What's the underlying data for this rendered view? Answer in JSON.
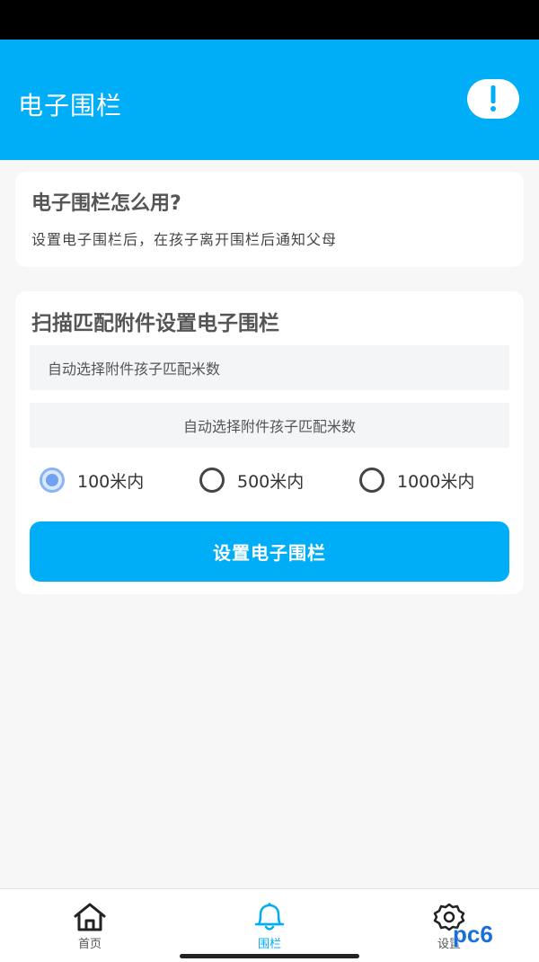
{
  "header": {
    "title": "电子围栏",
    "info_icon": "exclamation-icon"
  },
  "colors": {
    "accent": "#00adf7",
    "background": "#f7f7f7",
    "radio_selected": "#6fa2f3"
  },
  "howto_card": {
    "title": "电子围栏怎么用?",
    "description": "设置电子围栏后，在孩子离开围栏后通知父母"
  },
  "setup_card": {
    "title": "扫描匹配附件设置电子围栏",
    "field_1_text": "自动选择附件孩子匹配米数",
    "field_2_text": "自动选择附件孩子匹配米数",
    "radio_options": [
      {
        "label": "100米内",
        "selected": true
      },
      {
        "label": "500米内",
        "selected": false
      },
      {
        "label": "1000米内",
        "selected": false
      }
    ],
    "submit_label": "设置电子围栏"
  },
  "tab_bar": {
    "tabs": [
      {
        "label": "首页",
        "icon": "home-icon",
        "active": false
      },
      {
        "label": "围栏",
        "icon": "bell-icon",
        "active": true
      },
      {
        "label": "设置",
        "icon": "gear-icon",
        "active": false
      }
    ]
  },
  "watermark": {
    "text": "pc6"
  }
}
